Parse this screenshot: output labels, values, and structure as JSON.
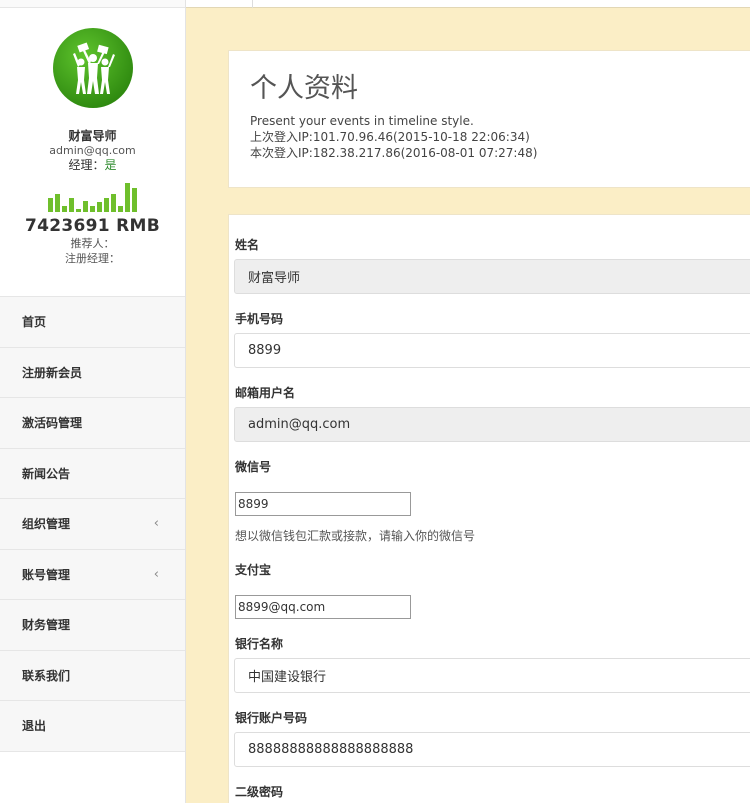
{
  "profile": {
    "name": "财富导师",
    "email": "admin@qq.com",
    "manager_label": "经理：",
    "manager_value": "是",
    "money": "7423691 RMB",
    "referrer_label": "推荐人：",
    "reg_manager_label": "注册经理：",
    "spark_values": [
      0.45,
      0.55,
      0.2,
      0.45,
      0.1,
      0.35,
      0.2,
      0.3,
      0.45,
      0.55,
      0.2,
      0.9,
      0.75
    ]
  },
  "menu": {
    "items": [
      {
        "label": "首页",
        "chevron": ""
      },
      {
        "label": "注册新会员",
        "chevron": ""
      },
      {
        "label": "激活码管理",
        "chevron": ""
      },
      {
        "label": "新闻公告",
        "chevron": ""
      },
      {
        "label": "组织管理",
        "chevron": "‹"
      },
      {
        "label": "账号管理",
        "chevron": "‹"
      },
      {
        "label": "财务管理",
        "chevron": ""
      },
      {
        "label": "联系我们",
        "chevron": ""
      },
      {
        "label": "退出",
        "chevron": ""
      }
    ]
  },
  "header": {
    "title": "个人资料",
    "subtitle": "Present your events in timeline style.",
    "last_login": "上次登入IP:101.70.96.46(2015-10-18 22:06:34)",
    "current_login": "本次登入IP:182.38.217.86(2016-08-01 07:27:48)"
  },
  "form": {
    "name_label": "姓名",
    "name_value": "财富导师",
    "phone_label": "手机号码",
    "phone_value": "8899",
    "email_label": "邮箱用户名",
    "email_value": "admin@qq.com",
    "wechat_label": "微信号",
    "wechat_value": "8899",
    "wechat_help": "想以微信钱包汇款或接款，请输入你的微信号",
    "alipay_label": "支付宝",
    "alipay_value": "8899@qq.com",
    "bank_label": "银行名称",
    "bank_value": "中国建设银行",
    "account_label": "银行账户号码",
    "account_value": "88888888888888888888",
    "pwd2_label": "二级密码"
  },
  "colors": {
    "accent_green": "#6fbf2c",
    "page_background": "#fbeec6"
  }
}
